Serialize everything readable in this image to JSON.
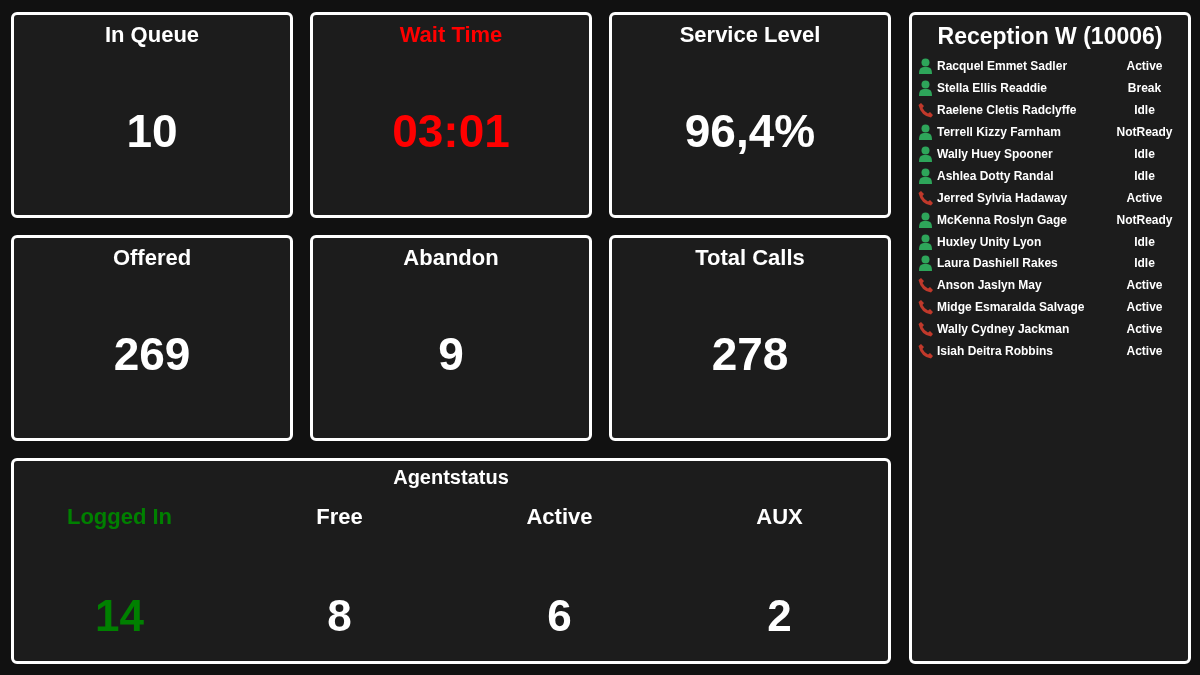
{
  "tiles": [
    {
      "title": "In Queue",
      "value": "10",
      "color": "#ffffff"
    },
    {
      "title": "Wait Time",
      "value": "03:01",
      "color": "#ff0000"
    },
    {
      "title": "Service Level",
      "value": "96,4%",
      "color": "#ffffff"
    },
    {
      "title": "Offered",
      "value": "269",
      "color": "#ffffff"
    },
    {
      "title": "Abandon",
      "value": "9",
      "color": "#ffffff"
    },
    {
      "title": "Total Calls",
      "value": "278",
      "color": "#ffffff"
    }
  ],
  "agentstatus": {
    "title": "Agentstatus",
    "columns": [
      {
        "label": "Logged In",
        "value": "14",
        "color": "#008000"
      },
      {
        "label": "Free",
        "value": "8",
        "color": "#ffffff"
      },
      {
        "label": "Active",
        "value": "6",
        "color": "#ffffff"
      },
      {
        "label": "AUX",
        "value": "2",
        "color": "#ffffff"
      }
    ]
  },
  "queue": {
    "title": "Reception W (10006)",
    "agents": [
      {
        "kind": "person",
        "name": "Racquel Emmet Sadler",
        "status": "Active"
      },
      {
        "kind": "person",
        "name": "Stella Ellis Readdie",
        "status": "Break"
      },
      {
        "kind": "phone",
        "name": "Raelene Cletis Radclyffe",
        "status": "Idle"
      },
      {
        "kind": "person",
        "name": "Terrell Kizzy Farnham",
        "status": "NotReady"
      },
      {
        "kind": "person",
        "name": "Wally Huey Spooner",
        "status": "Idle"
      },
      {
        "kind": "person",
        "name": "Ashlea Dotty Randal",
        "status": "Idle"
      },
      {
        "kind": "phone",
        "name": "Jerred Sylvia Hadaway",
        "status": "Active"
      },
      {
        "kind": "person",
        "name": "McKenna Roslyn Gage",
        "status": "NotReady"
      },
      {
        "kind": "person",
        "name": "Huxley Unity Lyon",
        "status": "Idle"
      },
      {
        "kind": "person",
        "name": "Laura Dashiell Rakes",
        "status": "Idle"
      },
      {
        "kind": "phone",
        "name": "Anson Jaslyn May",
        "status": "Active"
      },
      {
        "kind": "phone",
        "name": "Midge Esmaralda Salvage",
        "status": "Active"
      },
      {
        "kind": "phone",
        "name": "Wally Cydney Jackman",
        "status": "Active"
      },
      {
        "kind": "phone",
        "name": "Isiah Deitra Robbins",
        "status": "Active"
      }
    ]
  }
}
